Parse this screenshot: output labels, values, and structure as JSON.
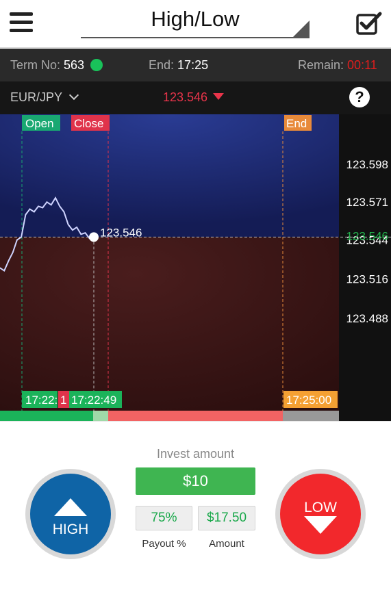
{
  "header": {
    "title": "High/Low"
  },
  "info": {
    "term_label": "Term No:",
    "term_value": "563",
    "end_label": "End:",
    "end_value": "17:25",
    "remain_label": "Remain:",
    "remain_value": "00:11"
  },
  "asset": {
    "pair": "EUR/JPY",
    "price": "123.546",
    "direction": "down",
    "help": "?"
  },
  "chart": {
    "tags": {
      "open": "Open",
      "close": "Close",
      "end": "End"
    },
    "y_ticks": [
      {
        "label": "123.598",
        "value": 123.598
      },
      {
        "label": "123.571",
        "value": 123.571
      },
      {
        "label": "123.544",
        "value": 123.544
      },
      {
        "label": "123.516",
        "value": 123.516
      },
      {
        "label": "123.488",
        "value": 123.488
      }
    ],
    "current_price_label": "123.546",
    "current_price_value": 123.546,
    "time_labels": {
      "open": "17:22:",
      "close_partial": "1",
      "current": "17:22:49",
      "end": "17:25:00"
    },
    "series": [
      [
        0,
        123.524
      ],
      [
        1,
        123.522
      ],
      [
        2,
        123.529
      ],
      [
        3,
        123.535
      ],
      [
        4,
        123.544
      ],
      [
        5,
        123.546
      ],
      [
        6,
        123.562
      ],
      [
        7,
        123.566
      ],
      [
        8,
        123.564
      ],
      [
        9,
        123.568
      ],
      [
        10,
        123.567
      ],
      [
        11,
        123.571
      ],
      [
        12,
        123.569
      ],
      [
        13,
        123.574
      ],
      [
        14,
        123.568
      ],
      [
        15,
        123.564
      ],
      [
        16,
        123.555
      ],
      [
        17,
        123.551
      ],
      [
        18,
        123.553
      ],
      [
        19,
        123.548
      ],
      [
        20,
        123.549
      ],
      [
        21,
        123.545
      ],
      [
        22,
        123.546
      ]
    ],
    "colors": {
      "above": "#1e2f7a",
      "below": "#3a1616",
      "line": "#cfd4ff",
      "open": "#19a872",
      "close": "#e0334b",
      "end": "#e88a3a",
      "axis_highlight": "#22b24c"
    }
  },
  "progress": {
    "elapsed_fraction": 0.275,
    "colors": [
      "#1bb35a",
      "#9fd9a8",
      "#f26363",
      "#999999"
    ]
  },
  "trade": {
    "invest_label": "Invest amount",
    "amount": "$10",
    "payout_value": "75%",
    "payout_label": "Payout %",
    "return_value": "$17.50",
    "return_label": "Amount",
    "high_label": "HIGH",
    "low_label": "LOW"
  }
}
